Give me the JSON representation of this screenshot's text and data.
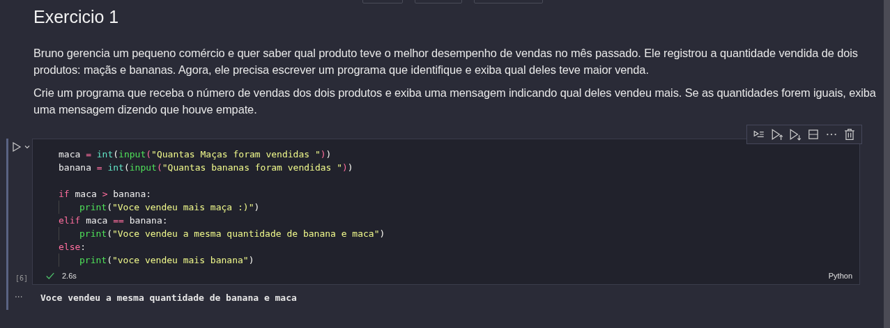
{
  "markdown": {
    "heading": "Exercicio 1",
    "paragraphs": [
      "Bruno gerencia um pequeno comércio e quer saber qual produto teve o melhor desempenho de vendas no mês passado. Ele registrou a quantidade vendida de dois produtos: maçãs e bananas. Agora, ele precisa escrever um programa que identifique e exiba qual deles teve maior venda.",
      "Crie um programa que receba o número de vendas dos dois produtos e exiba uma mensagem indicando qual deles vendeu mais. Se as quantidades forem iguais, exiba uma mensagem dizendo que houve empate."
    ]
  },
  "cell": {
    "execution_count": "[6]",
    "status_ok": true,
    "duration": "2.6s",
    "language": "Python",
    "output": "Voce vendeu a mesma quantidade de banana e maca",
    "output_menu": "···",
    "lines": [
      {
        "indent": false,
        "tokens": [
          {
            "kind": "name",
            "text": "maca"
          },
          {
            "kind": "op",
            "text": " = "
          },
          {
            "kind": "builtin",
            "text": "int"
          },
          {
            "kind": "paren1",
            "text": "("
          },
          {
            "kind": "func",
            "text": "input"
          },
          {
            "kind": "paren2",
            "text": "("
          },
          {
            "kind": "string",
            "text": "\"Quantas Maças foram vendidas \""
          },
          {
            "kind": "paren2",
            "text": ")"
          },
          {
            "kind": "paren1",
            "text": ")"
          }
        ]
      },
      {
        "indent": false,
        "tokens": [
          {
            "kind": "name",
            "text": "banana"
          },
          {
            "kind": "op",
            "text": " = "
          },
          {
            "kind": "builtin",
            "text": "int"
          },
          {
            "kind": "paren1",
            "text": "("
          },
          {
            "kind": "func",
            "text": "input"
          },
          {
            "kind": "paren2",
            "text": "("
          },
          {
            "kind": "string",
            "text": "\"Quantas bananas foram vendidas \""
          },
          {
            "kind": "paren2",
            "text": ")"
          },
          {
            "kind": "paren1",
            "text": ")"
          }
        ]
      },
      {
        "indent": false
      },
      {
        "indent": false,
        "tokens": [
          {
            "kind": "keyword",
            "text": "if"
          },
          {
            "kind": "name",
            "text": " maca "
          },
          {
            "kind": "op",
            "text": ">"
          },
          {
            "kind": "name",
            "text": " banana:"
          }
        ]
      },
      {
        "indent": true,
        "tokens": [
          {
            "kind": "func",
            "text": "print"
          },
          {
            "kind": "paren1",
            "text": "("
          },
          {
            "kind": "string",
            "text": "\"Voce vendeu mais maça :)\""
          },
          {
            "kind": "paren1",
            "text": ")"
          }
        ]
      },
      {
        "indent": false,
        "tokens": [
          {
            "kind": "keyword",
            "text": "elif"
          },
          {
            "kind": "name",
            "text": " maca "
          },
          {
            "kind": "op",
            "text": "=="
          },
          {
            "kind": "name",
            "text": " banana:"
          }
        ]
      },
      {
        "indent": true,
        "tokens": [
          {
            "kind": "func",
            "text": "print"
          },
          {
            "kind": "paren1",
            "text": "("
          },
          {
            "kind": "string",
            "text": "\"Voce vendeu a mesma quantidade de banana e maca\""
          },
          {
            "kind": "paren1",
            "text": ")"
          }
        ]
      },
      {
        "indent": false,
        "tokens": [
          {
            "kind": "keyword",
            "text": "else"
          },
          {
            "kind": "name",
            "text": ":"
          }
        ]
      },
      {
        "indent": true,
        "tokens": [
          {
            "kind": "func",
            "text": "print"
          },
          {
            "kind": "paren1",
            "text": "("
          },
          {
            "kind": "string",
            "text": "\"voce vendeu mais banana\""
          },
          {
            "kind": "paren1",
            "text": ")"
          }
        ]
      }
    ]
  }
}
